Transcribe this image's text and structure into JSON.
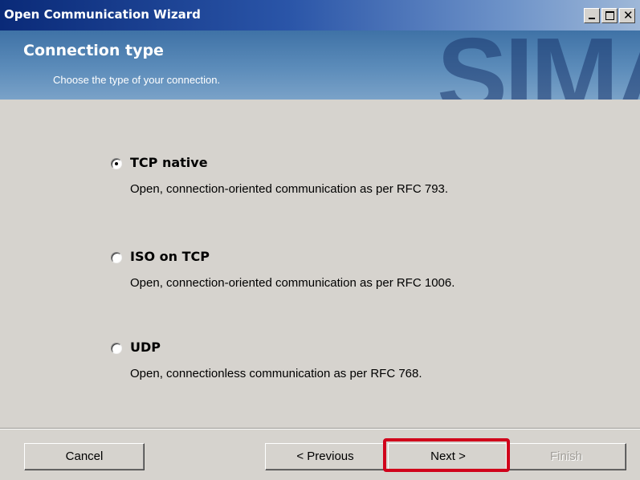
{
  "window": {
    "title": "Open Communication Wizard",
    "controls": {
      "close_glyph": "✕"
    }
  },
  "header": {
    "title": "Connection type",
    "subtitle": "Choose the type of your connection.",
    "watermark": "SIMA"
  },
  "options": [
    {
      "label": "TCP native",
      "description": "Open, connection-oriented communication as per RFC 793.",
      "selected": true
    },
    {
      "label": "ISO on TCP",
      "description": "Open, connection-oriented communication as per RFC 1006.",
      "selected": false
    },
    {
      "label": "UDP",
      "description": "Open, connectionless communication as per RFC 768.",
      "selected": false
    }
  ],
  "buttons": {
    "cancel": "Cancel",
    "previous": "< Previous",
    "next": "Next >",
    "finish": "Finish"
  },
  "states": {
    "finish_enabled": false,
    "next_highlighted": true
  },
  "colors": {
    "title_bar": "#0a2a78",
    "header_bg": "#5c8cba",
    "dialog_bg": "#d6d3ce",
    "highlight": "#d0021b"
  }
}
